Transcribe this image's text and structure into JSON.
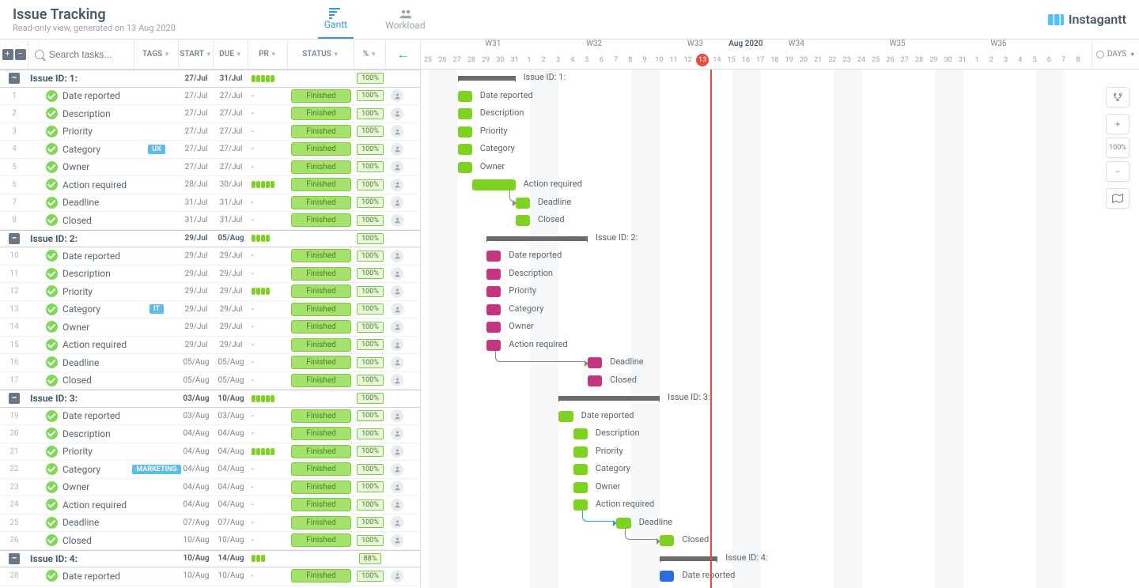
{
  "header": {
    "title": "Issue Tracking",
    "subtitle": "Read-only view, generated on 13 Aug 2020",
    "tabs": [
      {
        "label": "Gantt",
        "active": true
      },
      {
        "label": "Workload",
        "active": false
      }
    ],
    "brand": "Instagantt"
  },
  "toolbar": {
    "searchPlaceholder": "Search tasks...",
    "columns": {
      "tags": "TAGS",
      "start": "START",
      "due": "DUE",
      "pr": "PR",
      "status": "STATUS",
      "pct": "%"
    },
    "daysLabel": "DAYS"
  },
  "timeline": {
    "monthMain": "Aug 2020",
    "weeks": [
      {
        "label": "W31",
        "pos": 5
      },
      {
        "label": "W32",
        "pos": 12
      },
      {
        "label": "W33",
        "pos": 19
      },
      {
        "label": "W34",
        "pos": 26
      },
      {
        "label": "W35",
        "pos": 33
      },
      {
        "label": "W36",
        "pos": 40
      }
    ],
    "days": [
      25,
      26,
      27,
      28,
      29,
      30,
      31,
      1,
      2,
      3,
      4,
      5,
      6,
      7,
      8,
      9,
      10,
      11,
      12,
      13,
      14,
      15,
      16,
      17,
      18,
      19,
      20,
      21,
      22,
      23,
      24,
      25,
      26,
      27,
      28,
      29,
      30,
      31,
      1,
      2,
      3,
      4,
      5,
      6,
      7,
      8
    ],
    "today": 13,
    "todayIdx": 19,
    "weekendIdx": [
      0,
      1,
      7,
      8,
      14,
      15,
      21,
      22,
      28,
      29,
      35,
      36,
      42,
      43
    ]
  },
  "sideControls": {
    "zoomPct": "100%"
  },
  "rows": [
    {
      "type": "section",
      "name": "Issue ID: 1:",
      "start": "27/Jul",
      "due": "31/Jul",
      "pr": 5,
      "prColor": "#7ed321",
      "pct": "100%",
      "startIdx": 2,
      "endIdx": 6
    },
    {
      "type": "task",
      "idx": 1,
      "name": "Date reported",
      "start": "27/Jul",
      "due": "27/Jul",
      "status": "Finished",
      "pct": "100%",
      "color": "green",
      "startIdx": 2,
      "endIdx": 3
    },
    {
      "type": "task",
      "idx": 2,
      "name": "Description",
      "start": "27/Jul",
      "due": "27/Jul",
      "status": "Finished",
      "pct": "100%",
      "color": "green",
      "startIdx": 2,
      "endIdx": 3
    },
    {
      "type": "task",
      "idx": 3,
      "name": "Priority",
      "start": "27/Jul",
      "due": "27/Jul",
      "status": "Finished",
      "pct": "100%",
      "color": "green",
      "startIdx": 2,
      "endIdx": 3
    },
    {
      "type": "task",
      "idx": 4,
      "name": "Category",
      "tag": "UX",
      "tagColor": "#5ebde8",
      "start": "27/Jul",
      "due": "27/Jul",
      "status": "Finished",
      "pct": "100%",
      "color": "green",
      "startIdx": 2,
      "endIdx": 3
    },
    {
      "type": "task",
      "idx": 5,
      "name": "Owner",
      "start": "27/Jul",
      "due": "27/Jul",
      "status": "Finished",
      "pct": "100%",
      "color": "green",
      "startIdx": 2,
      "endIdx": 3
    },
    {
      "type": "task",
      "idx": 6,
      "name": "Action required",
      "start": "28/Jul",
      "due": "30/Jul",
      "pr": 5,
      "prColor": "#7ed321",
      "status": "Finished",
      "pct": "100%",
      "color": "green",
      "startIdx": 3,
      "endIdx": 6,
      "depDown": 1
    },
    {
      "type": "task",
      "idx": 7,
      "name": "Deadline",
      "start": "31/Jul",
      "due": "31/Jul",
      "status": "Finished",
      "pct": "100%",
      "color": "green",
      "startIdx": 6,
      "endIdx": 7
    },
    {
      "type": "task",
      "idx": 8,
      "name": "Closed",
      "start": "31/Jul",
      "due": "31/Jul",
      "status": "Finished",
      "pct": "100%",
      "color": "green",
      "startIdx": 6,
      "endIdx": 7
    },
    {
      "type": "section",
      "name": "Issue ID: 2:",
      "start": "29/Jul",
      "due": "05/Aug",
      "pr": 4,
      "prColor": "#7ed321",
      "pct": "100%",
      "startIdx": 4,
      "endIdx": 11
    },
    {
      "type": "task",
      "idx": 10,
      "name": "Date reported",
      "start": "29/Jul",
      "due": "29/Jul",
      "status": "Finished",
      "pct": "100%",
      "color": "magenta",
      "startIdx": 4,
      "endIdx": 5
    },
    {
      "type": "task",
      "idx": 11,
      "name": "Description",
      "start": "29/Jul",
      "due": "29/Jul",
      "status": "Finished",
      "pct": "100%",
      "color": "magenta",
      "startIdx": 4,
      "endIdx": 5
    },
    {
      "type": "task",
      "idx": 12,
      "name": "Priority",
      "start": "29/Jul",
      "due": "29/Jul",
      "pr": 4,
      "prColor": "#7ed321",
      "status": "Finished",
      "pct": "100%",
      "color": "magenta",
      "startIdx": 4,
      "endIdx": 5
    },
    {
      "type": "task",
      "idx": 13,
      "name": "Category",
      "tag": "IT",
      "tagColor": "#5ebde8",
      "start": "29/Jul",
      "due": "29/Jul",
      "status": "Finished",
      "pct": "100%",
      "color": "magenta",
      "startIdx": 4,
      "endIdx": 5
    },
    {
      "type": "task",
      "idx": 14,
      "name": "Owner",
      "start": "29/Jul",
      "due": "29/Jul",
      "status": "Finished",
      "pct": "100%",
      "color": "magenta",
      "startIdx": 4,
      "endIdx": 5
    },
    {
      "type": "task",
      "idx": 15,
      "name": "Action required",
      "start": "29/Jul",
      "due": "29/Jul",
      "status": "Finished",
      "pct": "100%",
      "color": "magenta",
      "startIdx": 4,
      "endIdx": 5,
      "depDown": 1,
      "depDownEnd": 11
    },
    {
      "type": "task",
      "idx": 16,
      "name": "Deadline",
      "start": "05/Aug",
      "due": "05/Aug",
      "status": "Finished",
      "pct": "100%",
      "color": "magenta",
      "startIdx": 11,
      "endIdx": 12
    },
    {
      "type": "task",
      "idx": 17,
      "name": "Closed",
      "start": "05/Aug",
      "due": "05/Aug",
      "status": "Finished",
      "pct": "100%",
      "color": "magenta",
      "startIdx": 11,
      "endIdx": 12
    },
    {
      "type": "section",
      "name": "Issue ID: 3:",
      "start": "03/Aug",
      "due": "10/Aug",
      "pr": 5,
      "prColor": "#7ed321",
      "pct": "100%",
      "startIdx": 9,
      "endIdx": 16
    },
    {
      "type": "task",
      "idx": 19,
      "name": "Date reported",
      "start": "03/Aug",
      "due": "03/Aug",
      "status": "Finished",
      "pct": "100%",
      "color": "green",
      "startIdx": 9,
      "endIdx": 10
    },
    {
      "type": "task",
      "idx": 20,
      "name": "Description",
      "start": "04/Aug",
      "due": "04/Aug",
      "status": "Finished",
      "pct": "100%",
      "color": "green",
      "startIdx": 10,
      "endIdx": 11
    },
    {
      "type": "task",
      "idx": 21,
      "name": "Priority",
      "start": "04/Aug",
      "due": "04/Aug",
      "pr": 5,
      "prColor": "#7ed321",
      "status": "Finished",
      "pct": "100%",
      "color": "green",
      "startIdx": 10,
      "endIdx": 11
    },
    {
      "type": "task",
      "idx": 22,
      "name": "Category",
      "tag": "MARKETING",
      "tagColor": "#5ebde8",
      "start": "04/Aug",
      "due": "04/Aug",
      "status": "Finished",
      "pct": "100%",
      "color": "green",
      "startIdx": 10,
      "endIdx": 11
    },
    {
      "type": "task",
      "idx": 23,
      "name": "Owner",
      "start": "04/Aug",
      "due": "04/Aug",
      "status": "Finished",
      "pct": "100%",
      "color": "green",
      "startIdx": 10,
      "endIdx": 11
    },
    {
      "type": "task",
      "idx": 24,
      "name": "Action required",
      "start": "04/Aug",
      "due": "04/Aug",
      "status": "Finished",
      "pct": "100%",
      "color": "green",
      "startIdx": 10,
      "endIdx": 11,
      "depDown": 1,
      "depDownEnd": 13,
      "depColor": "blue"
    },
    {
      "type": "task",
      "idx": 25,
      "name": "Deadline",
      "start": "07/Aug",
      "due": "07/Aug",
      "status": "Finished",
      "pct": "100%",
      "color": "green",
      "startIdx": 13,
      "endIdx": 14,
      "depDown": 1,
      "depDownEnd": 16
    },
    {
      "type": "task",
      "idx": 26,
      "name": "Closed",
      "start": "10/Aug",
      "due": "10/Aug",
      "status": "Finished",
      "pct": "100%",
      "color": "green",
      "startIdx": 16,
      "endIdx": 17
    },
    {
      "type": "section",
      "name": "Issue ID: 4:",
      "start": "10/Aug",
      "due": "14/Aug",
      "pr": 3,
      "prColor": "#7ed321",
      "pct": "88%",
      "startIdx": 16,
      "endIdx": 20
    },
    {
      "type": "task",
      "idx": 28,
      "name": "Date reported",
      "start": "10/Aug",
      "due": "10/Aug",
      "status": "Finished",
      "pct": "100%",
      "color": "blue",
      "startIdx": 16,
      "endIdx": 17
    }
  ]
}
